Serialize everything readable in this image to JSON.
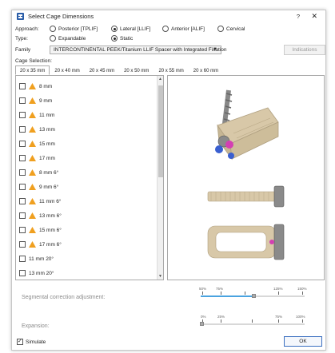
{
  "window": {
    "title": "Select Cage Dimensions",
    "help": "?",
    "close": "✕"
  },
  "approach": {
    "label": "Approach:",
    "options": [
      "Posterior [TPLIF]",
      "Lateral [LLIF]",
      "Anterior [ALIF]",
      "Cervical"
    ],
    "selected": "Lateral [LLIF]"
  },
  "type": {
    "label": "Type:",
    "options": [
      "Expandable",
      "Static"
    ],
    "selected": "Static"
  },
  "family": {
    "label": "Family",
    "value": "INTERCONTINENTAL PEEK/Titanium LLIF Spacer with Integrated Fixation",
    "arrow": "▼"
  },
  "indications_button": "Indications",
  "cage_selection_label": "Cage Selection:",
  "tabs": [
    "20 x 35 mm",
    "20 x 40 mm",
    "20 x 45 mm",
    "20 x 50 mm",
    "20 x 55 mm",
    "20 x 60 mm"
  ],
  "active_tab": "20 x 35 mm",
  "cage_items": [
    {
      "label": "8 mm",
      "warning": true
    },
    {
      "label": "9 mm",
      "warning": true
    },
    {
      "label": "11 mm",
      "warning": true
    },
    {
      "label": "13 mm",
      "warning": true
    },
    {
      "label": "15 mm",
      "warning": true
    },
    {
      "label": "17 mm",
      "warning": true
    },
    {
      "label": "8 mm 6°",
      "warning": true
    },
    {
      "label": "9 mm 6°",
      "warning": true
    },
    {
      "label": "11 mm 6°",
      "warning": true
    },
    {
      "label": "13 mm 6°",
      "warning": true
    },
    {
      "label": "15 mm 6°",
      "warning": true
    },
    {
      "label": "17 mm 6°",
      "warning": true
    },
    {
      "label": "11 mm 20°",
      "warning": false
    },
    {
      "label": "13 mm 20°",
      "warning": false
    }
  ],
  "segmental": {
    "label": "Segmental correction adjustment:",
    "ticks": [
      "50%",
      "75%",
      "",
      "125%",
      "150%"
    ],
    "value_fraction": 0.58
  },
  "expansion": {
    "label": "Expansion:",
    "ticks": [
      "0%",
      "25%",
      "",
      "75%",
      "100%"
    ],
    "value_fraction": 0.0
  },
  "simulate_label": "Simulate",
  "ok_button": "OK",
  "colors": {
    "warning": "#f0a020",
    "implant_beige": "#d8c8a8",
    "screw_gray": "#8a8a8a",
    "marker_pink": "#d43fb3",
    "marker_blue": "#3a5fd0",
    "accent": "#4aa3e0"
  }
}
